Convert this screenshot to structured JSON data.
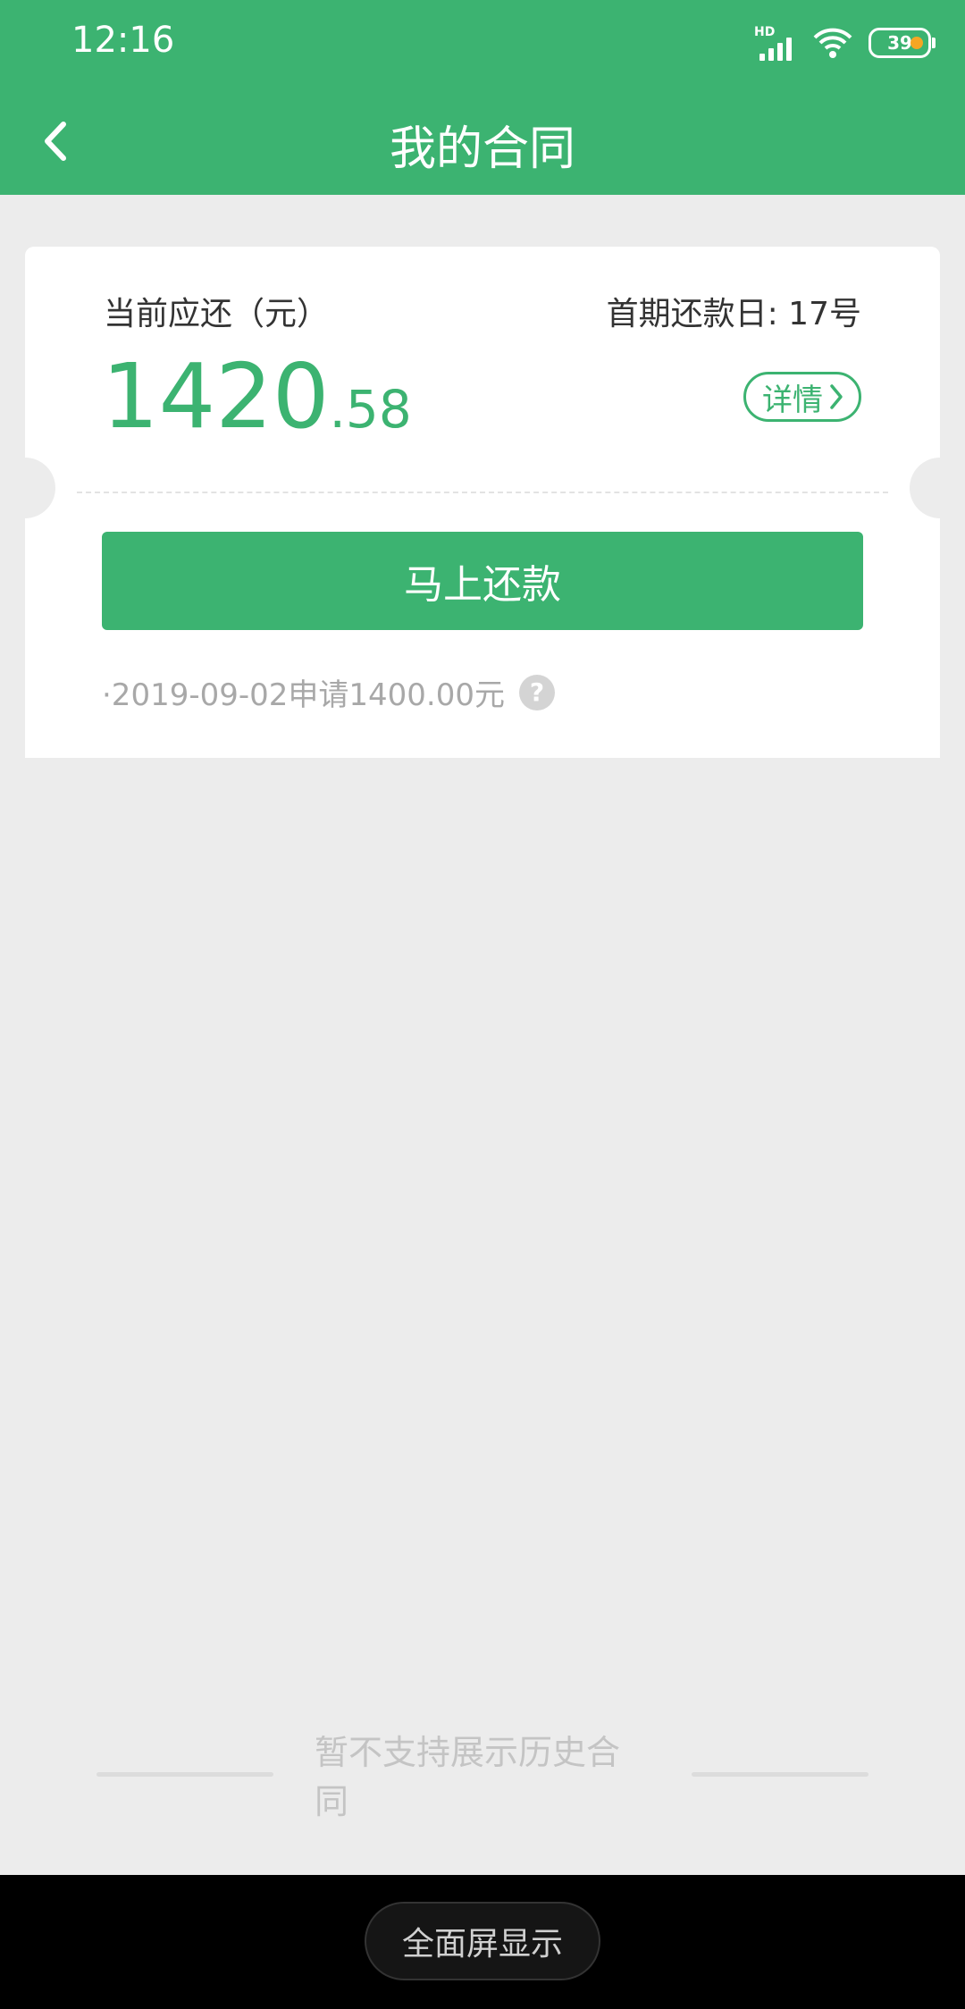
{
  "status_bar": {
    "time": "12:16",
    "network_label": "HD",
    "battery_level": "39"
  },
  "navbar": {
    "title": "我的合同"
  },
  "contract_card": {
    "current_due_label": "当前应还（元）",
    "first_repayment_label": "首期还款日: 17号",
    "amount_integer": "1420",
    "amount_decimal": ".58",
    "detail_label": "详情",
    "repay_button_label": "马上还款",
    "application_note": "·2019-09-02申请1400.00元"
  },
  "history_note": "暂不支持展示历史合同",
  "system_bar": {
    "fullscreen_label": "全面屏显示"
  },
  "colors": {
    "brand": "#3cb371",
    "background": "#ececec",
    "battery_dot": "#f5a623"
  },
  "icons": [
    "signal-icon",
    "wifi-icon",
    "battery-icon",
    "back-arrow-icon",
    "chevron-right-icon",
    "help-icon"
  ]
}
